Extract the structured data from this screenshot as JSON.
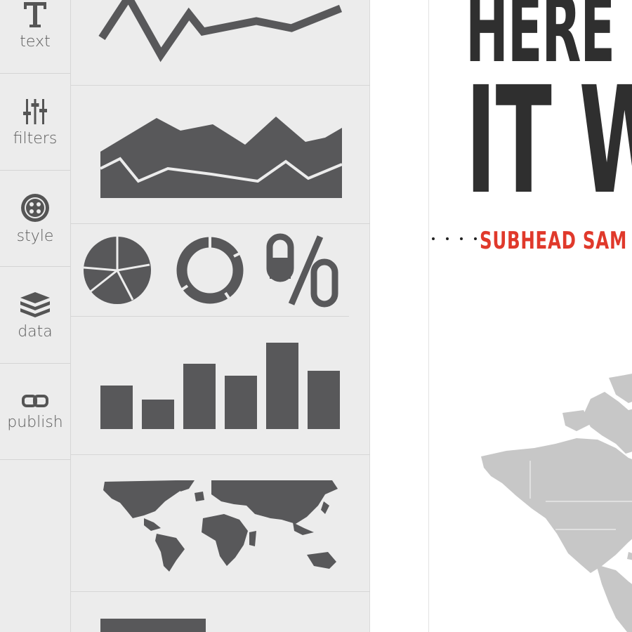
{
  "rail": {
    "items": [
      {
        "label": "text",
        "icon": "text-icon"
      },
      {
        "label": "filters",
        "icon": "filters-icon"
      },
      {
        "label": "style",
        "icon": "style-icon"
      },
      {
        "label": "data",
        "icon": "layers-icon"
      },
      {
        "label": "publish",
        "icon": "link-icon"
      }
    ]
  },
  "palette": {
    "widgets": [
      "line chart",
      "area chart",
      "pie / donut / percent",
      "bar chart",
      "world map",
      "table"
    ],
    "percent_glyph": "0%"
  },
  "canvas": {
    "headline_line1": "HERE",
    "headline_line2": "IT W",
    "subhead": "SUBHEAD SAM"
  },
  "colors": {
    "rail_bg": "#ececec",
    "widget_gray": "#58585a",
    "headline": "#2f2f2f",
    "subhead_accent": "#e0392b",
    "map_gray": "#c7c7c7"
  }
}
